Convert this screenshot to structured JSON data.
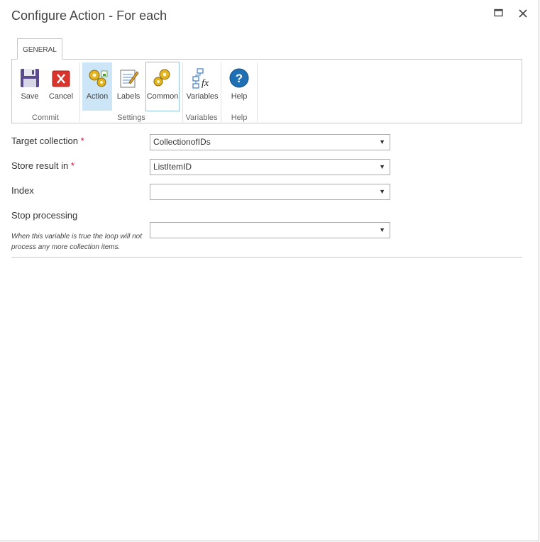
{
  "window": {
    "title": "Configure Action - For each"
  },
  "ribbon": {
    "tab_label": "GENERAL",
    "groups": {
      "commit": "Commit",
      "settings": "Settings",
      "variables": "Variables",
      "help": "Help"
    },
    "buttons": {
      "save": "Save",
      "cancel": "Cancel",
      "action": "Action",
      "labels": "Labels",
      "common": "Common",
      "variables": "Variables",
      "help": "Help"
    }
  },
  "form": {
    "target_collection": {
      "label": "Target collection",
      "required_mark": "*",
      "value": "CollectionofIDs"
    },
    "store_result_in": {
      "label": "Store result in",
      "required_mark": "*",
      "value": "ListItemID"
    },
    "index": {
      "label": "Index",
      "value": ""
    },
    "stop_processing": {
      "label": "Stop processing",
      "help": "When this variable is true the loop will not process any more collection items.",
      "value": ""
    },
    "dropdown_arrow": "▼"
  },
  "colors": {
    "selected_bg": "#cde6f7",
    "required": "#c8102e",
    "help_icon": "#1f6fb5",
    "cancel_icon": "#d9342b"
  }
}
